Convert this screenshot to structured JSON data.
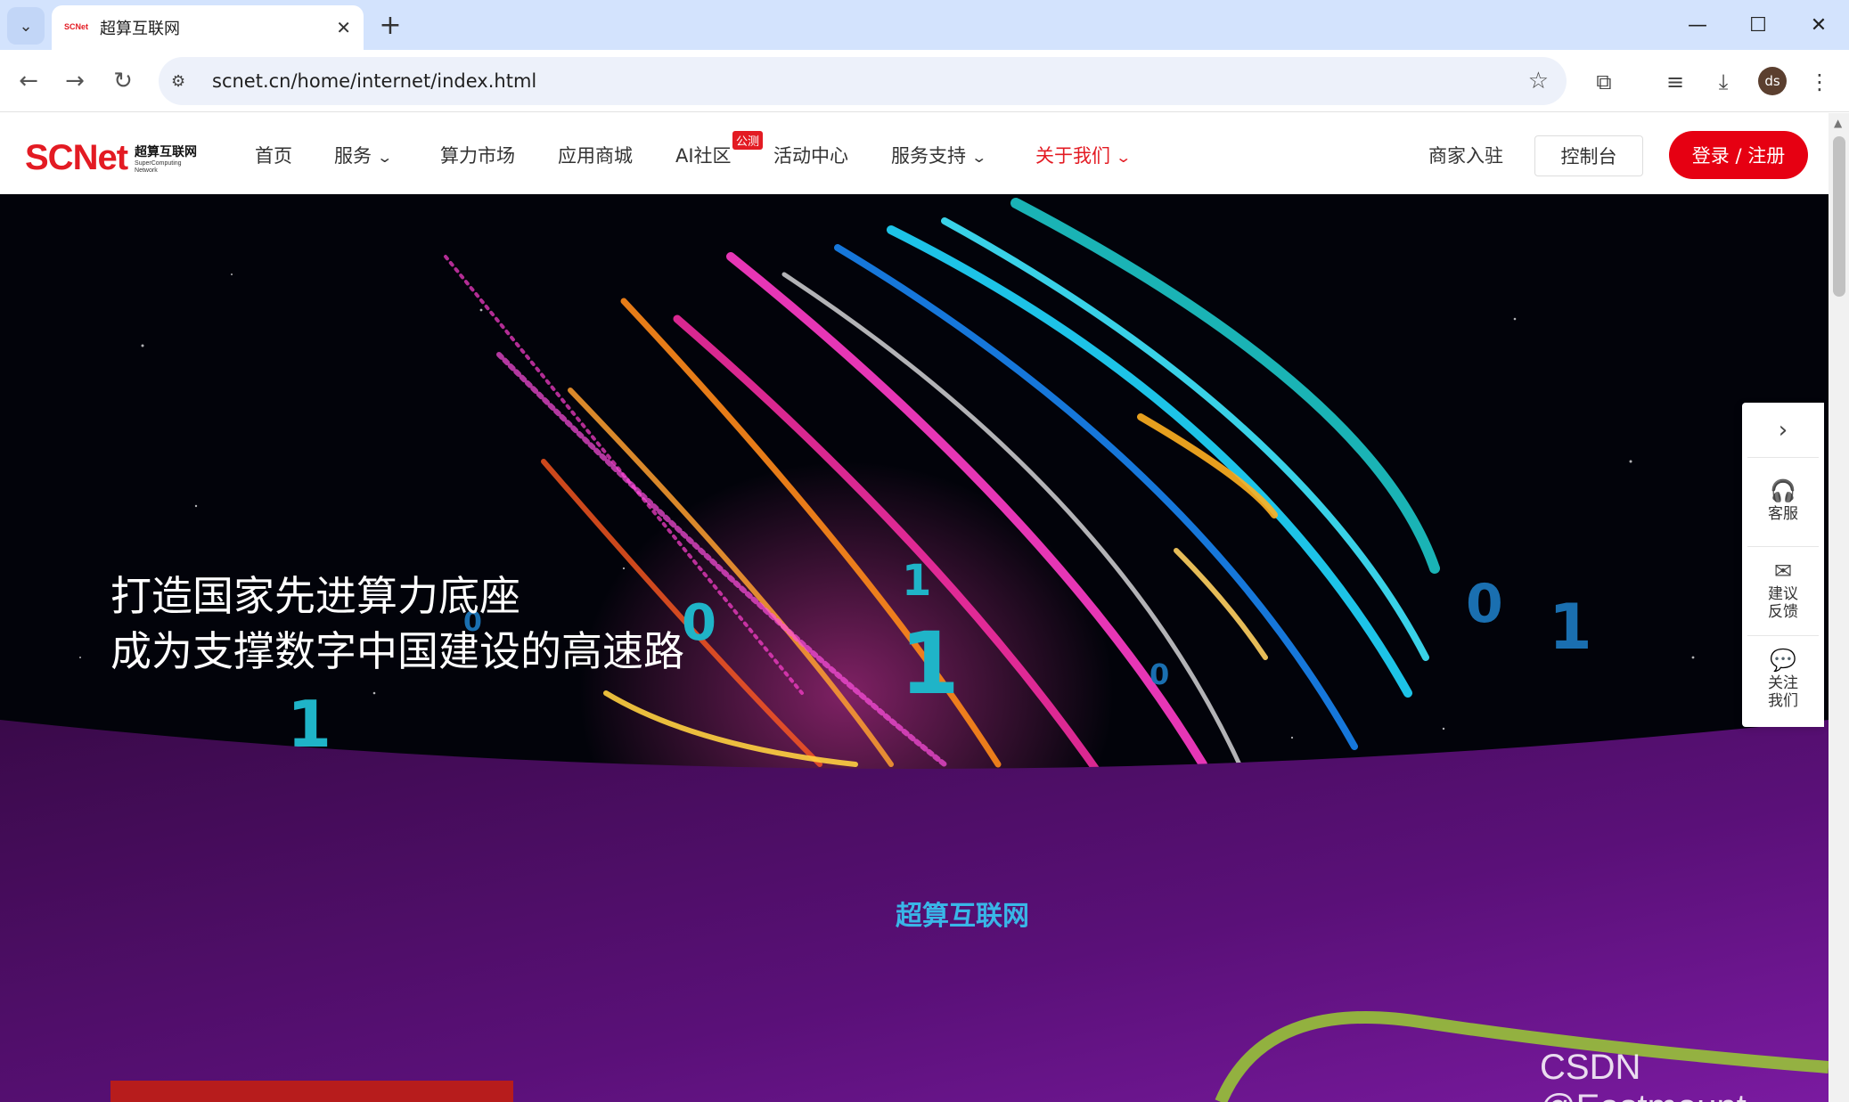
{
  "browser": {
    "tab_title": "超算互联网",
    "favicon_text": "SCNet",
    "url": "scnet.cn/home/internet/index.html",
    "avatar_initials": "ds",
    "icons": {
      "tab_list": "chevron-down-icon",
      "close_tab": "close-icon",
      "new_tab": "plus-icon",
      "minimize": "minimize-icon",
      "maximize": "maximize-icon",
      "close_window": "close-icon",
      "back": "arrow-left-icon",
      "forward": "arrow-right-icon",
      "reload": "reload-icon",
      "site_info": "tune-icon",
      "bookmark": "star-icon",
      "extensions": "puzzle-icon",
      "media": "playlist-icon",
      "downloads": "download-icon",
      "menu": "kebab-menu-icon"
    }
  },
  "header": {
    "logo_mark": "SCNet",
    "logo_cn": "超算互联网",
    "logo_en_1": "SuperComputing",
    "logo_en_2": "Network",
    "nav": [
      {
        "label": "首页"
      },
      {
        "label": "服务"
      },
      {
        "label": "算力市场"
      },
      {
        "label": "应用商城"
      },
      {
        "label": "AI社区"
      },
      {
        "label": "活动中心"
      },
      {
        "label": "服务支持"
      },
      {
        "label": "关于我们"
      }
    ],
    "ai_badge": "公测",
    "merchant": "商家入驻",
    "console": "控制台",
    "login": "登录 / 注册",
    "accent_color": "#e60012"
  },
  "hero": {
    "slogan_line1": "打造国家先进算力底座",
    "slogan_line2": "成为支撑数字中国建设的高速路",
    "section_title": "超算互联网"
  },
  "side_panel": {
    "items": [
      {
        "label": "客服",
        "icon": "headset-icon"
      },
      {
        "label": "建议\n反馈",
        "icon": "feedback-mail-icon"
      },
      {
        "label": "关注\n我们",
        "icon": "wechat-icon"
      }
    ]
  },
  "watermark": "CSDN @Eastmount"
}
